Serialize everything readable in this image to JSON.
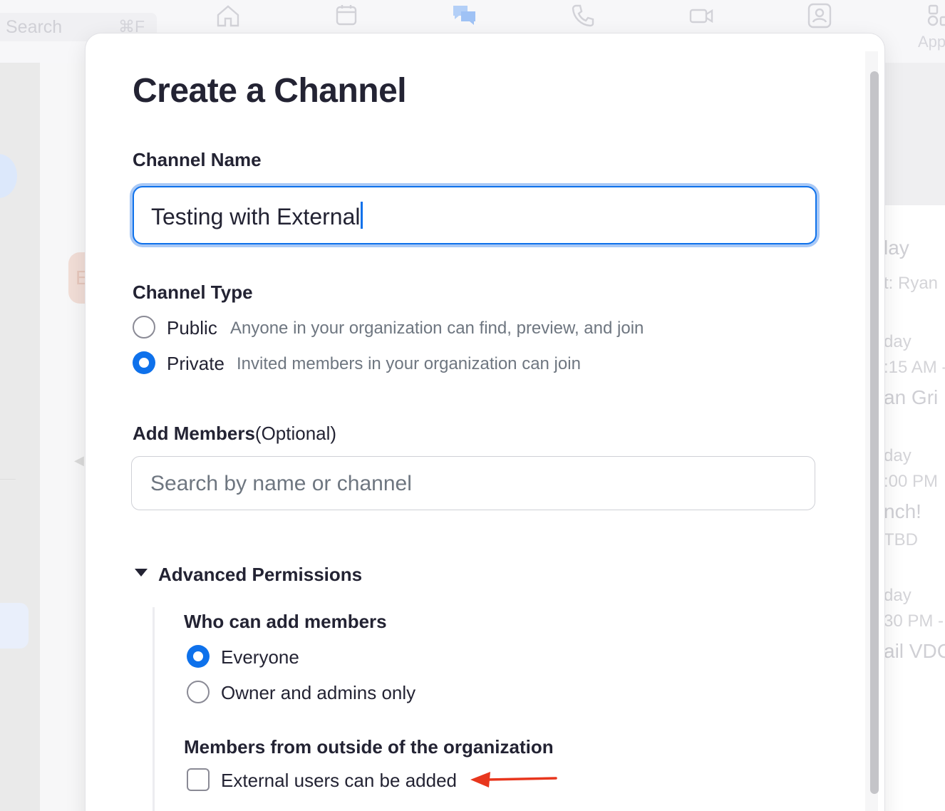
{
  "background": {
    "search_placeholder": "Search",
    "search_shortcut": "⌘F",
    "apps_label": "App",
    "nav_icons": [
      "home-icon",
      "calendar-icon",
      "chat-icon",
      "phone-icon",
      "video-icon",
      "contacts-icon",
      "apps-icon"
    ],
    "left_avatar_letter": "E",
    "right_fragments": [
      "lay",
      "t:  Ryan",
      "day",
      ":15 AM -",
      "an Gri",
      "day",
      ":00 PM",
      "nch!",
      "TBD",
      "day",
      "30 PM -",
      "ail VDC"
    ]
  },
  "modal": {
    "title": "Create a Channel",
    "channel_name": {
      "label": "Channel Name",
      "value": "Testing with External"
    },
    "channel_type": {
      "label": "Channel Type",
      "options": [
        {
          "label": "Public",
          "description": "Anyone in your organization can find, preview, and join",
          "selected": false
        },
        {
          "label": "Private",
          "description": "Invited members in your organization can join",
          "selected": true
        }
      ]
    },
    "add_members": {
      "label": "Add Members",
      "optional": "(Optional)",
      "placeholder": "Search by name or channel"
    },
    "advanced": {
      "label": "Advanced Permissions",
      "expanded": true,
      "who_can_add": {
        "label": "Who can add members",
        "options": [
          {
            "label": "Everyone",
            "selected": true
          },
          {
            "label": "Owner and admins only",
            "selected": false
          }
        ]
      },
      "external": {
        "label": "Members from outside of the organization",
        "checkbox_label": "External users can be added",
        "checked": false
      }
    }
  },
  "colors": {
    "accent": "#0e71eb",
    "annotation_arrow": "#e8361d",
    "text": "#232333",
    "muted": "#6e7680"
  }
}
